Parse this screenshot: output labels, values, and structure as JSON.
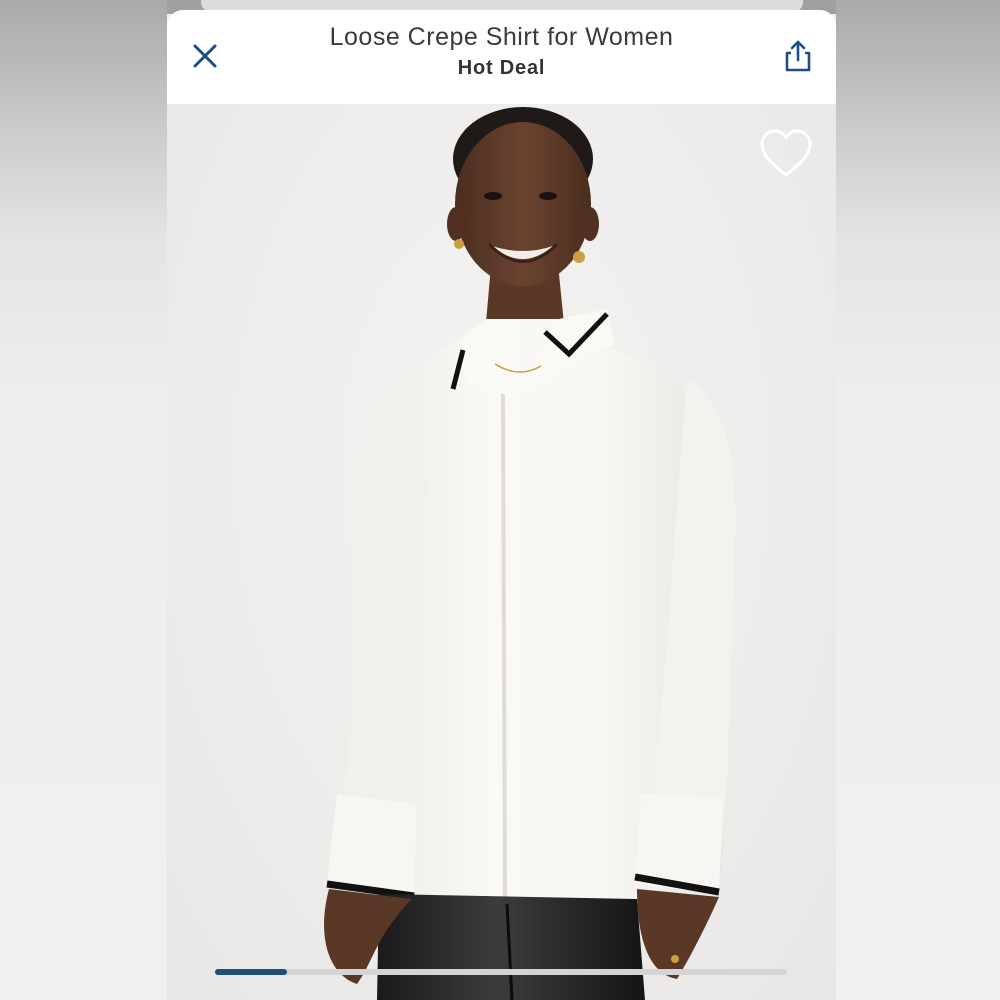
{
  "header": {
    "title": "Loose Crepe Shirt for Women",
    "subtitle": "Hot Deal",
    "close_icon": "close-icon",
    "share_icon": "share-icon"
  },
  "product_image": {
    "favorite_icon": "heart-outline-icon",
    "carousel_progress": 0.125
  },
  "colors": {
    "accent": "#1f4e79",
    "icon_blue": "#1d4e89",
    "track": "#d4d4d4"
  }
}
